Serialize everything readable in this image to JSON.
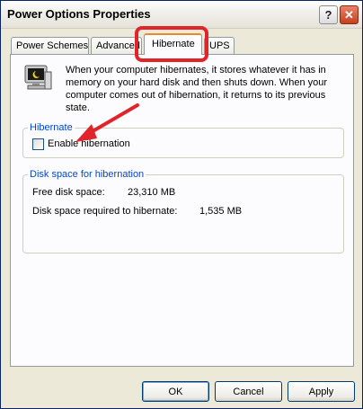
{
  "window": {
    "title": "Power Options Properties"
  },
  "titlebar_buttons": {
    "help": "?",
    "close": "✕"
  },
  "tabs": [
    {
      "label": "Power Schemes",
      "active": false
    },
    {
      "label": "Advanced",
      "active": false
    },
    {
      "label": "Hibernate",
      "active": true
    },
    {
      "label": "UPS",
      "active": false
    }
  ],
  "info": {
    "icon": "hibernate-computer-icon",
    "text": "When your computer hibernates, it stores whatever it has in memory on your hard disk and then shuts down. When your computer comes out of hibernation, it returns to its previous state."
  },
  "hibernate_group": {
    "title": "Hibernate",
    "checkbox_label": "Enable hibernation",
    "checked": false
  },
  "disk_group": {
    "title": "Disk space for hibernation",
    "free_label": "Free disk space:",
    "free_value": "23,310 MB",
    "required_label": "Disk space required to hibernate:",
    "required_value": "1,535 MB"
  },
  "buttons": {
    "ok": "OK",
    "cancel": "Cancel",
    "apply": "Apply"
  },
  "annotation_colors": {
    "highlight": "#e0242a",
    "arrow": "#e0242a"
  },
  "colors": {
    "window_bg": "#ece9d8",
    "panel_bg": "#fcfcfe",
    "group_title": "#0046d5",
    "active_tab_accent": "#e68b2c"
  }
}
